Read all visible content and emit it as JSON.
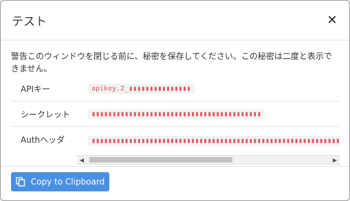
{
  "dialog": {
    "title": "テスト",
    "close_icon": "close-icon",
    "warning": "警告このウィンドウを閉じる前に、秘密を保存してください。この秘密は二度と表示できません。"
  },
  "fields": [
    {
      "label": "APIキー",
      "value": "apikey.2_▮▮▮▮▮▮▮▮▮▮▮▮▮▮▮"
    },
    {
      "label": "シークレット",
      "value": "▮▮▮▮▮▮▮▮▮▮▮▮▮▮▮▮▮▮▮▮▮▮▮▮▮▮▮▮▮▮▮▮▮▮▮▮▮▮▮▮▮"
    },
    {
      "label": "Authヘッダ",
      "value": "▮▮▮▮▮▮▮▮▮▮▮▮▮▮▮▮▮▮▮▮▮▮▮▮▮▮▮▮▮▮▮▮▮▮▮▮▮▮▮▮▮▮▮▮▮▮▮▮▮▮▮▮▮▮▮▮▮▮▮▮▮▮▮▮▮▮▮▮"
    }
  ],
  "actions": {
    "copy_label": "Copy to Clipboard",
    "copy_icon": "copy-icon"
  },
  "colors": {
    "accent": "#4a90e2",
    "value_text": "#e0555f"
  }
}
